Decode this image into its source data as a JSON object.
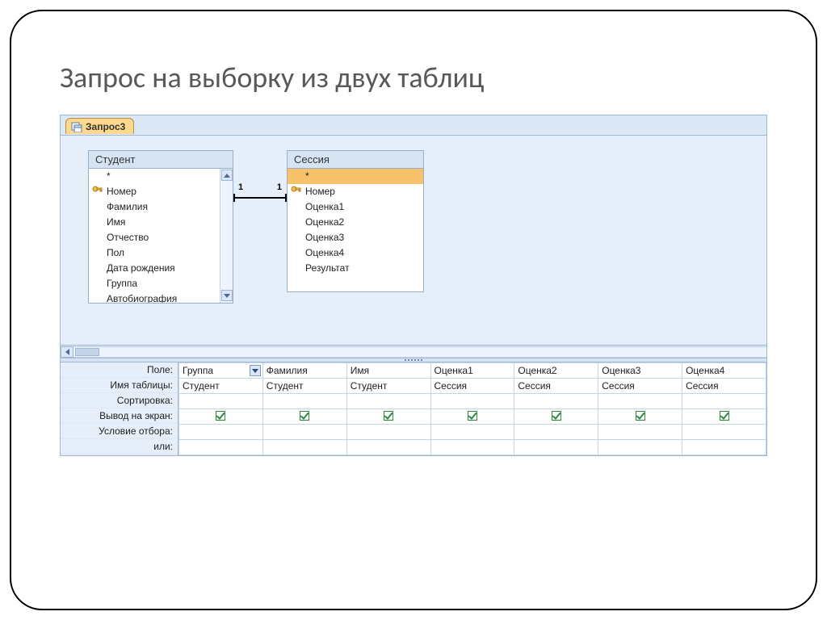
{
  "slide": {
    "title": "Запрос на выборку из двух таблиц"
  },
  "tab": {
    "label": "Запрос3"
  },
  "tables": {
    "student": {
      "title": "Студент",
      "fields": [
        "*",
        "Номер",
        "Фамилия",
        "Имя",
        "Отчество",
        "Пол",
        "Дата рождения",
        "Группа",
        "Автобиография"
      ],
      "key_field_index": 1
    },
    "session": {
      "title": "Сессия",
      "fields": [
        "*",
        "Номер",
        "Оценка1",
        "Оценка2",
        "Оценка3",
        "Оценка4",
        "Результат"
      ],
      "key_field_index": 1,
      "selected_index": 0
    }
  },
  "relationship": {
    "left_label": "1",
    "right_label": "1"
  },
  "grid": {
    "row_labels": [
      "Поле:",
      "Имя таблицы:",
      "Сортировка:",
      "Вывод на экран:",
      "Условие отбора:",
      "или:"
    ],
    "columns": [
      {
        "field": "Группа",
        "table": "Студент",
        "show": true,
        "selected": true
      },
      {
        "field": "Фамилия",
        "table": "Студент",
        "show": true
      },
      {
        "field": "Имя",
        "table": "Студент",
        "show": true
      },
      {
        "field": "Оценка1",
        "table": "Сессия",
        "show": true
      },
      {
        "field": "Оценка2",
        "table": "Сессия",
        "show": true
      },
      {
        "field": "Оценка3",
        "table": "Сессия",
        "show": true
      },
      {
        "field": "Оценка4",
        "table": "Сессия",
        "show": true
      }
    ]
  }
}
